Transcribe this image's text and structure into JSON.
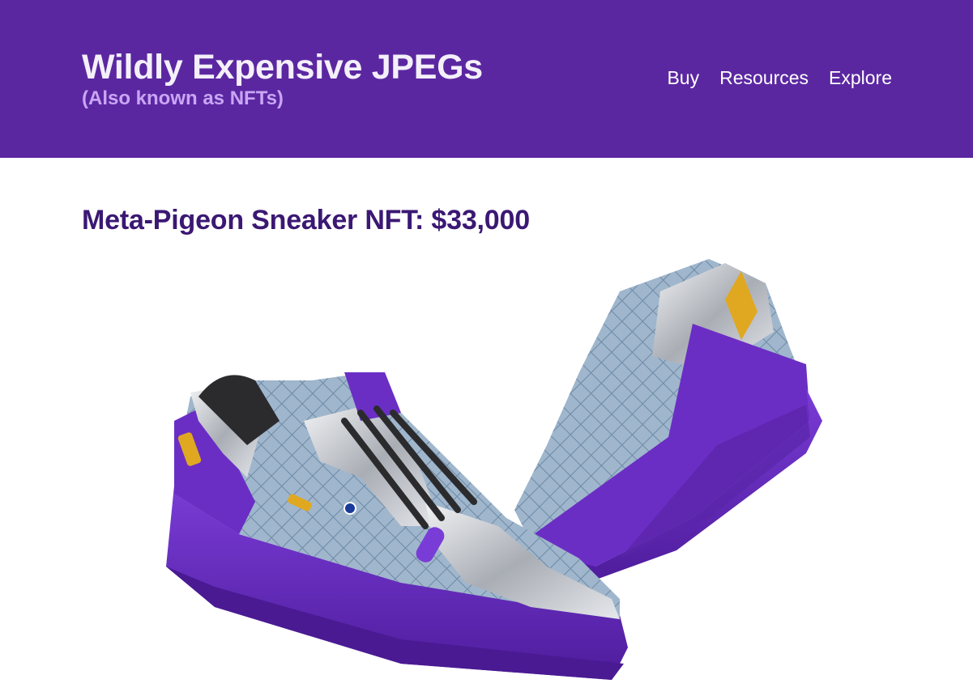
{
  "header": {
    "title": "Wildly Expensive JPEGs",
    "subtitle": "(Also known as NFTs)",
    "nav": [
      "Buy",
      "Resources",
      "Explore"
    ]
  },
  "main": {
    "product_title": "Meta-Pigeon Sneaker NFT: $33,000"
  },
  "colors": {
    "header_bg": "#5b27a1",
    "title": "#f4f0fa",
    "subtitle": "#c9a6f5",
    "heading": "#3b1873",
    "sneaker_sole": "#6a2cc0"
  }
}
